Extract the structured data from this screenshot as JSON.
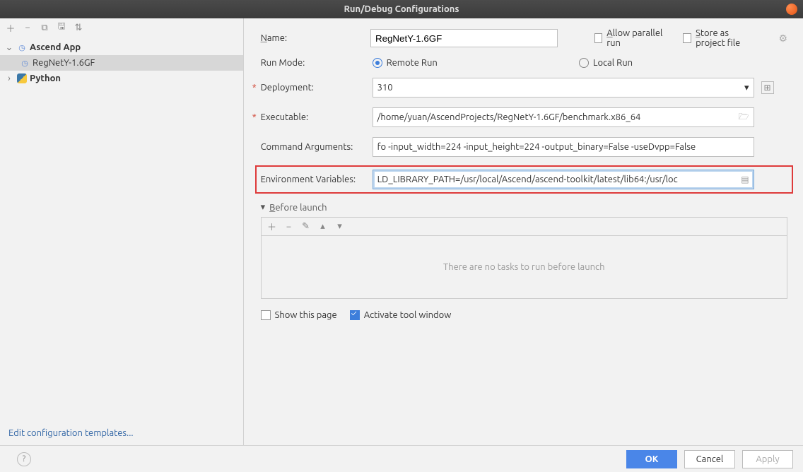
{
  "title": "Run/Debug Configurations",
  "tree": {
    "ascend_label": "Ascend App",
    "regnet_label": "RegNetY-1.6GF",
    "python_label": "Python"
  },
  "edit_templates_label": "Edit configuration templates...",
  "form": {
    "name_label": "Name:",
    "name_value": "RegNetY-1.6GF",
    "allow_parallel_label": "Allow parallel run",
    "store_label": "Store as project file",
    "run_mode_label": "Run Mode:",
    "remote_run_label": "Remote Run",
    "local_run_label": "Local Run",
    "deployment_label": "Deployment:",
    "deployment_value": "310",
    "executable_label": "Executable:",
    "executable_value": "/home/yuan/AscendProjects/RegNetY-1.6GF/benchmark.x86_64",
    "cmd_args_label": "Command Arguments:",
    "cmd_args_value": "fo -input_width=224 -input_height=224 -output_binary=False -useDvpp=False",
    "env_vars_label": "Environment Variables:",
    "env_vars_value": "LD_LIBRARY_PATH=/usr/local/Ascend/ascend-toolkit/latest/lib64:/usr/loc"
  },
  "before_launch": {
    "header": "Before launch",
    "empty_text": "There are no tasks to run before launch"
  },
  "bottom": {
    "show_page_label": "Show this page",
    "activate_label": "Activate tool window"
  },
  "footer": {
    "ok": "OK",
    "cancel": "Cancel",
    "apply": "Apply"
  }
}
